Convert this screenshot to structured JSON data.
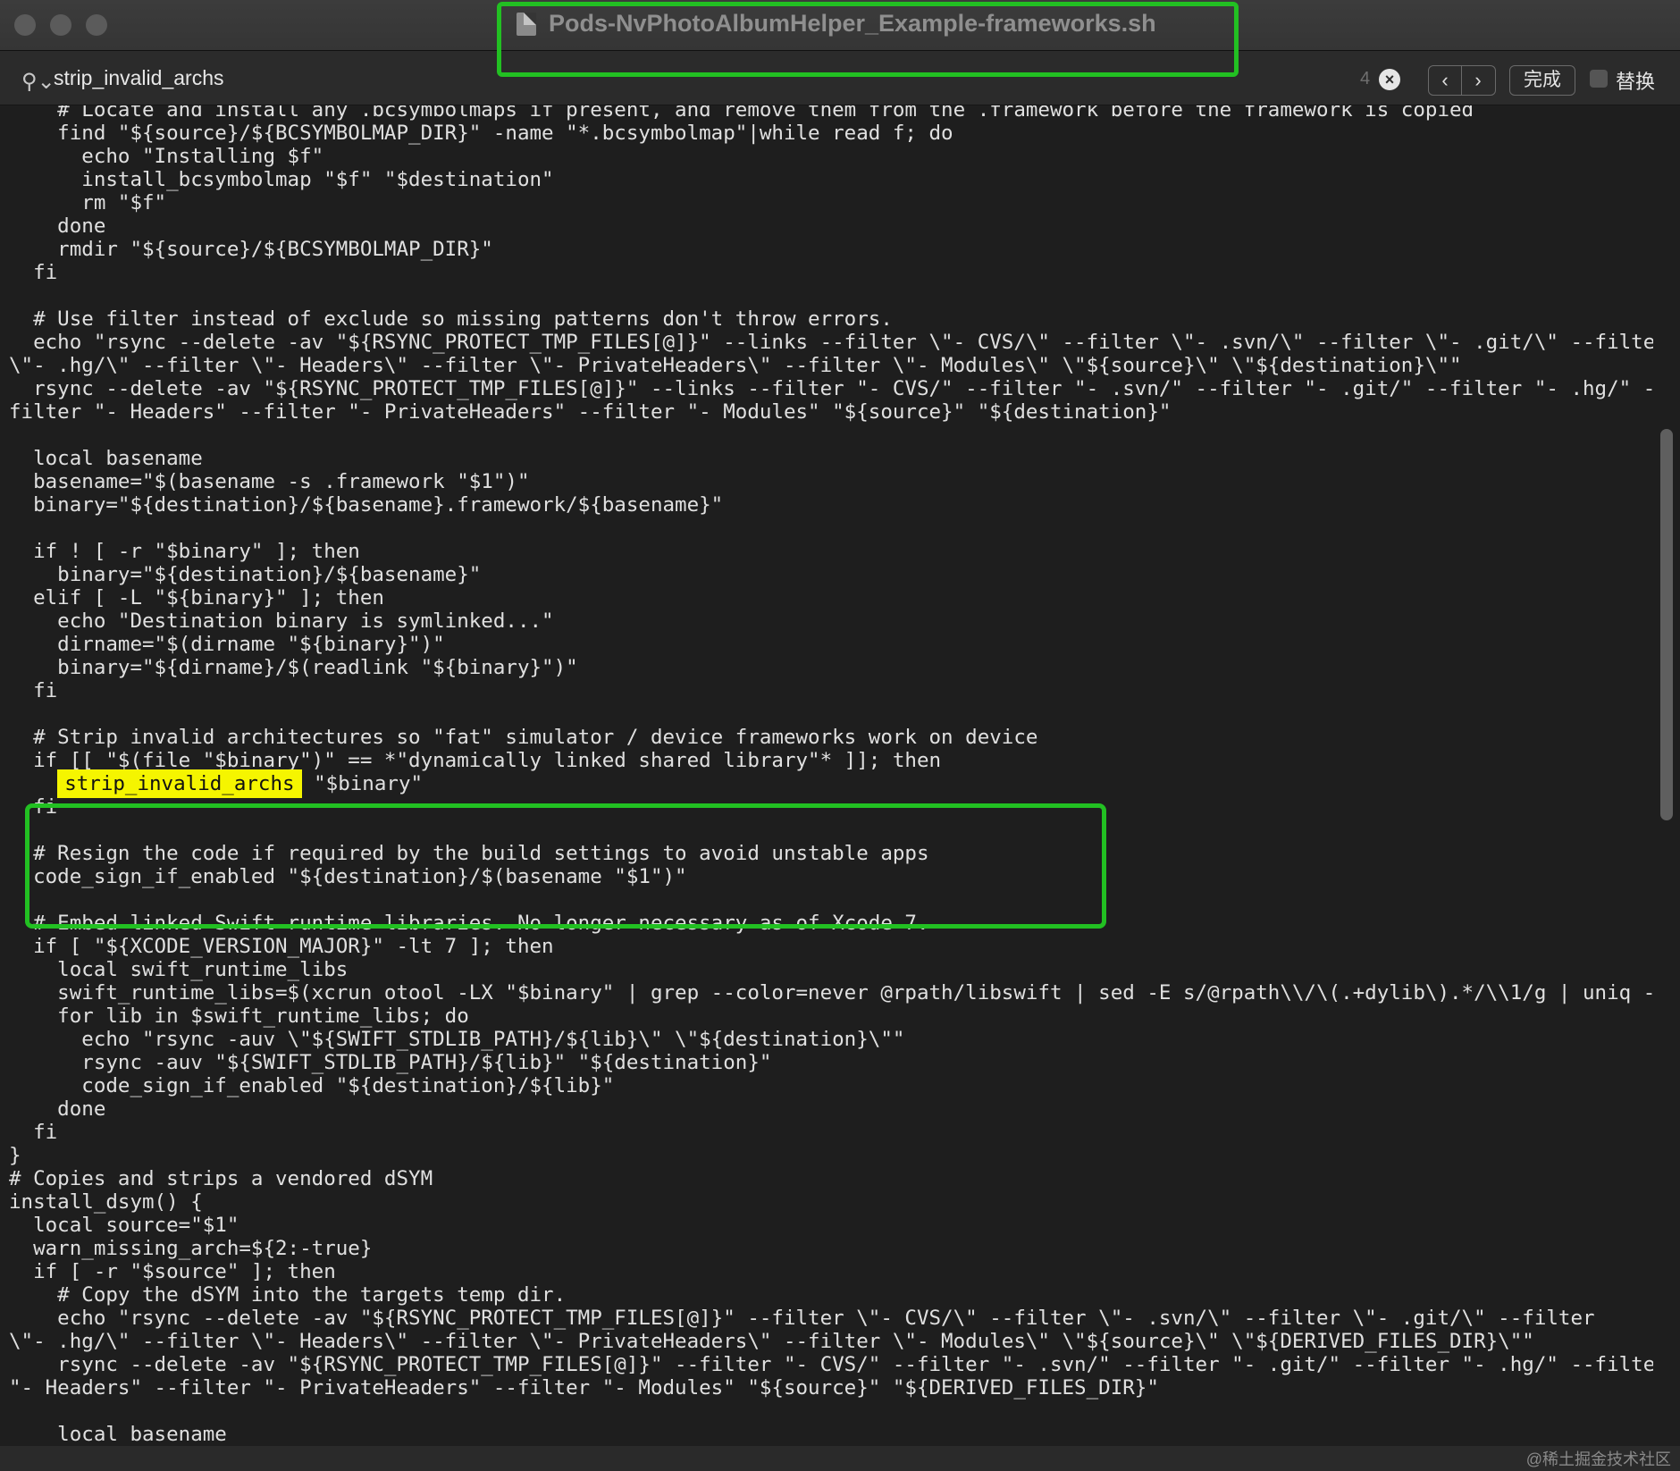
{
  "window": {
    "title": "Pods-NvPhotoAlbumHelper_Example-frameworks.sh"
  },
  "find": {
    "query": "strip_invalid_archs",
    "match_count": "4",
    "done_label": "完成",
    "replace_label": "替换"
  },
  "code": {
    "lines": [
      "    # Locate and install any .bcsymbolmaps if present, and remove them from the .framework before the framework is copied",
      "    find \"${source}/${BCSYMBOLMAP_DIR}\" -name \"*.bcsymbolmap\"|while read f; do",
      "      echo \"Installing $f\"",
      "      install_bcsymbolmap \"$f\" \"$destination\"",
      "      rm \"$f\"",
      "    done",
      "    rmdir \"${source}/${BCSYMBOLMAP_DIR}\"",
      "  fi",
      "",
      "  # Use filter instead of exclude so missing patterns don't throw errors.",
      "  echo \"rsync --delete -av \"${RSYNC_PROTECT_TMP_FILES[@]}\" --links --filter \\\"- CVS/\\\" --filter \\\"- .svn/\\\" --filter \\\"- .git/\\\" --filter",
      "\\\"- .hg/\\\" --filter \\\"- Headers\\\" --filter \\\"- PrivateHeaders\\\" --filter \\\"- Modules\\\" \\\"${source}\\\" \\\"${destination}\\\"\"",
      "  rsync --delete -av \"${RSYNC_PROTECT_TMP_FILES[@]}\" --links --filter \"- CVS/\" --filter \"- .svn/\" --filter \"- .git/\" --filter \"- .hg/\" --",
      "filter \"- Headers\" --filter \"- PrivateHeaders\" --filter \"- Modules\" \"${source}\" \"${destination}\"",
      "",
      "  local basename",
      "  basename=\"$(basename -s .framework \"$1\")\"",
      "  binary=\"${destination}/${basename}.framework/${basename}\"",
      "",
      "  if ! [ -r \"$binary\" ]; then",
      "    binary=\"${destination}/${basename}\"",
      "  elif [ -L \"${binary}\" ]; then",
      "    echo \"Destination binary is symlinked...\"",
      "    dirname=\"$(dirname \"${binary}\")\"",
      "    binary=\"${dirname}/$(readlink \"${binary}\")\"",
      "  fi",
      "",
      "  # Strip invalid architectures so \"fat\" simulator / device frameworks work on device",
      "  if [[ \"$(file \"$binary\")\" == *\"dynamically linked shared library\"* ]]; then",
      "    ",
      "  fi",
      "",
      "  # Resign the code if required by the build settings to avoid unstable apps",
      "  code_sign_if_enabled \"${destination}/$(basename \"$1\")\"",
      "",
      "  # Embed linked Swift runtime libraries. No longer necessary as of Xcode 7.",
      "  if [ \"${XCODE_VERSION_MAJOR}\" -lt 7 ]; then",
      "    local swift_runtime_libs",
      "    swift_runtime_libs=$(xcrun otool -LX \"$binary\" | grep --color=never @rpath/libswift | sed -E s/@rpath\\\\/\\(.+dylib\\).*/\\\\1/g | uniq -u)",
      "    for lib in $swift_runtime_libs; do",
      "      echo \"rsync -auv \\\"${SWIFT_STDLIB_PATH}/${lib}\\\" \\\"${destination}\\\"\"",
      "      rsync -auv \"${SWIFT_STDLIB_PATH}/${lib}\" \"${destination}\"",
      "      code_sign_if_enabled \"${destination}/${lib}\"",
      "    done",
      "  fi",
      "}",
      "# Copies and strips a vendored dSYM",
      "install_dsym() {",
      "  local source=\"$1\"",
      "  warn_missing_arch=${2:-true}",
      "  if [ -r \"$source\" ]; then",
      "    # Copy the dSYM into the targets temp dir.",
      "    echo \"rsync --delete -av \"${RSYNC_PROTECT_TMP_FILES[@]}\" --filter \\\"- CVS/\\\" --filter \\\"- .svn/\\\" --filter \\\"- .git/\\\" --filter",
      "\\\"- .hg/\\\" --filter \\\"- Headers\\\" --filter \\\"- PrivateHeaders\\\" --filter \\\"- Modules\\\" \\\"${source}\\\" \\\"${DERIVED_FILES_DIR}\\\"\"",
      "    rsync --delete -av \"${RSYNC_PROTECT_TMP_FILES[@]}\" --filter \"- CVS/\" --filter \"- .svn/\" --filter \"- .git/\" --filter \"- .hg/\" --filter",
      "\"- Headers\" --filter \"- PrivateHeaders\" --filter \"- Modules\" \"${source}\" \"${DERIVED_FILES_DIR}\"",
      "",
      "    local basename",
      "    basename=\"$(basename \"$source\")\""
    ],
    "highlight_line_match": "strip_invalid_archs",
    "highlight_line_suffix": " \"$binary\""
  },
  "watermark": "@稀土掘金技术社区",
  "colors": {
    "highlight": "#f5f500",
    "annotation_box": "#22c022",
    "editor_bg": "#1e1e1e"
  }
}
